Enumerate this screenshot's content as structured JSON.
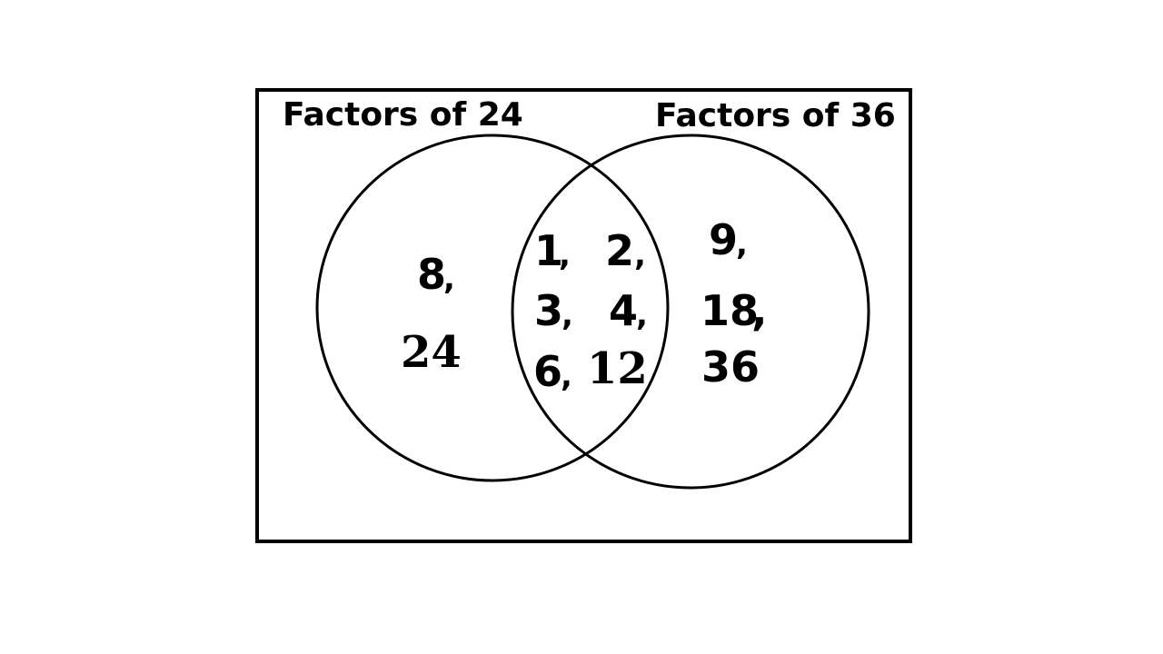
{
  "diagram": {
    "type": "venn",
    "set_a": {
      "title": "Factors of 24",
      "only": [
        "8",
        "24"
      ]
    },
    "set_b": {
      "title": "Factors of 36",
      "only": [
        "9",
        "18",
        "36"
      ]
    },
    "intersection": [
      "1",
      "2",
      "3",
      "4",
      "6",
      "12"
    ],
    "comma": ","
  }
}
